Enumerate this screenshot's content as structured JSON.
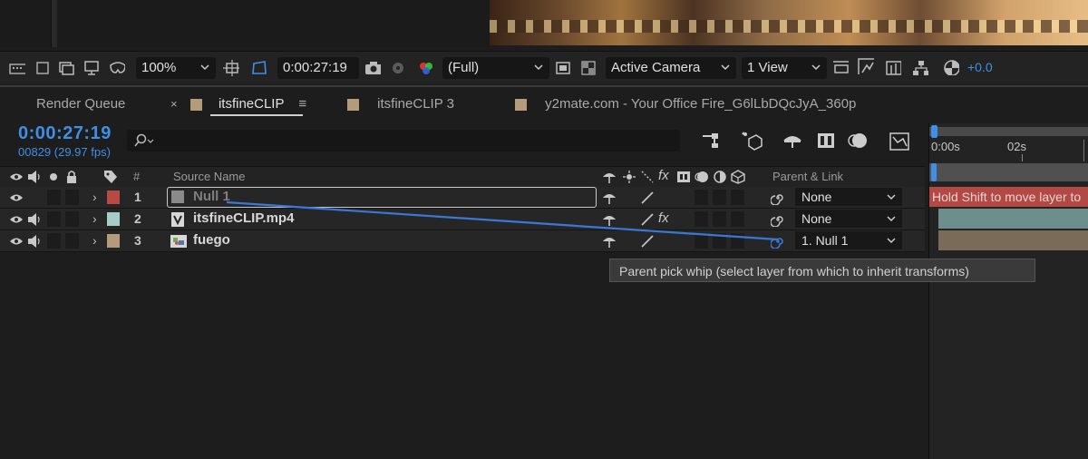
{
  "toolbar": {
    "zoom": "100%",
    "timecode": "0:00:27:19",
    "resolution": "(Full)",
    "camera": "Active Camera",
    "views": "1 View",
    "exposure": "+0.0"
  },
  "tabs": [
    {
      "label": "Render Queue"
    },
    {
      "label": "itsfineCLIP",
      "color": "#b39b7b"
    },
    {
      "label": "itsfineCLIP 3",
      "color": "#b39b7b"
    },
    {
      "label": "y2mate.com - Your Office Fire_G6lLbDQcJyA_360p",
      "color": "#b39b7b"
    }
  ],
  "comp": {
    "timecode": "0:00:27:19",
    "frame_info": "00829 (29.97 fps)"
  },
  "columns": {
    "number": "#",
    "source_name": "Source Name",
    "parent_link": "Parent & Link"
  },
  "layers": [
    {
      "num": "1",
      "name": "Null 1",
      "label_color": "#b84a44",
      "parent": "None"
    },
    {
      "num": "2",
      "name": "itsfineCLIP.mp4",
      "label_color": "#a7cdc8",
      "parent": "None"
    },
    {
      "num": "3",
      "name": "fuego",
      "label_color": "#b39b7b",
      "parent": "1. Null 1"
    }
  ],
  "timeline": {
    "ruler_start": "0:00s",
    "ruler_2s": "02s",
    "hint": "Hold Shift to move layer to"
  },
  "tooltip": "Parent pick whip (select layer from which to inherit transforms)",
  "colors": {
    "accent": "#3f8fe6",
    "pickwhip": "#3a78d6"
  }
}
